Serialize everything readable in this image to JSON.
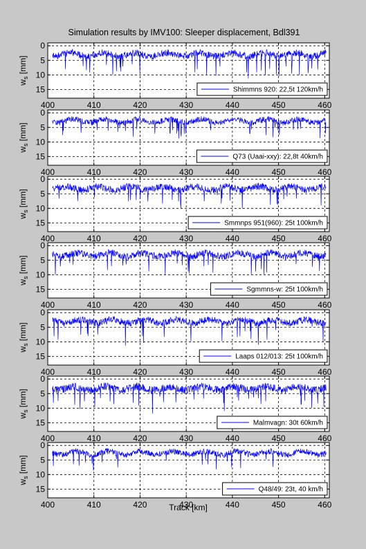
{
  "figure": {
    "title": "Simulation results by IMV100: Sleeper displacement, Bdl391",
    "xlabel": "Track [km]"
  },
  "chart_data": [
    {
      "type": "line",
      "ylabel": "w_s [mm]",
      "series": [
        {
          "name": "Shimmns 920: 22,5t 120km/h",
          "color": "#0000ff",
          "base": 3.0,
          "noise": 1.2,
          "spike": 7.5,
          "seed": 11
        }
      ],
      "xlim": [
        400,
        461
      ],
      "ylim": [
        18,
        -1
      ],
      "xticks": [
        400,
        410,
        420,
        430,
        440,
        450,
        460
      ],
      "yticks": [
        0,
        5,
        10,
        15
      ],
      "grid": true,
      "legend": "bottom-right"
    },
    {
      "type": "line",
      "ylabel": "w_s [mm]",
      "series": [
        {
          "name": "Q73 (Uaai-xxy): 22,8t 40km/h",
          "color": "#0000ff",
          "base": 2.8,
          "noise": 1.0,
          "spike": 5.5,
          "seed": 23
        }
      ],
      "xlim": [
        400,
        461
      ],
      "ylim": [
        18,
        -1
      ],
      "xticks": [
        400,
        410,
        420,
        430,
        440,
        450,
        460
      ],
      "yticks": [
        0,
        5,
        10,
        15
      ],
      "grid": true,
      "legend": "bottom-right"
    },
    {
      "type": "line",
      "ylabel": "w_s [mm]",
      "series": [
        {
          "name": "Smmnps 951(960): 25t 100km/h",
          "color": "#0000ff",
          "base": 3.1,
          "noise": 1.2,
          "spike": 7.0,
          "seed": 37
        }
      ],
      "xlim": [
        400,
        461
      ],
      "ylim": [
        18,
        -1
      ],
      "xticks": [
        400,
        410,
        420,
        430,
        440,
        450,
        460
      ],
      "yticks": [
        0,
        5,
        10,
        15
      ],
      "grid": true,
      "legend": "bottom-right"
    },
    {
      "type": "line",
      "ylabel": "w_s [mm]",
      "series": [
        {
          "name": "Sgmmns-w: 25t 100km/h",
          "color": "#0000ff",
          "base": 3.1,
          "noise": 1.2,
          "spike": 7.0,
          "seed": 41
        }
      ],
      "xlim": [
        400,
        461
      ],
      "ylim": [
        18,
        -1
      ],
      "xticks": [
        400,
        410,
        420,
        430,
        440,
        450,
        460
      ],
      "yticks": [
        0,
        5,
        10,
        15
      ],
      "grid": true,
      "legend": "bottom-right"
    },
    {
      "type": "line",
      "ylabel": "w_s [mm]",
      "series": [
        {
          "name": "Laaps 012/013: 25t 100km/h",
          "color": "#0000ff",
          "base": 3.0,
          "noise": 1.2,
          "spike": 7.2,
          "seed": 53
        }
      ],
      "xlim": [
        400,
        461
      ],
      "ylim": [
        18,
        -1
      ],
      "xticks": [
        400,
        410,
        420,
        430,
        440,
        450,
        460
      ],
      "yticks": [
        0,
        5,
        10,
        15
      ],
      "grid": true,
      "legend": "bottom-right"
    },
    {
      "type": "line",
      "ylabel": "w_s [mm]",
      "series": [
        {
          "name": "Malmvagn: 30t 60km/h",
          "color": "#0000ff",
          "base": 3.2,
          "noise": 1.3,
          "spike": 7.0,
          "seed": 67
        }
      ],
      "xlim": [
        400,
        461
      ],
      "ylim": [
        18,
        -1
      ],
      "xticks": [
        400,
        410,
        420,
        430,
        440,
        450,
        460
      ],
      "yticks": [
        0,
        5,
        10,
        15
      ],
      "grid": true,
      "legend": "bottom-right"
    },
    {
      "type": "line",
      "ylabel": "w_s [mm]",
      "series": [
        {
          "name": "Q48/49: 23t, 40 km/h",
          "color": "#0000ff",
          "base": 2.6,
          "noise": 1.0,
          "spike": 5.5,
          "seed": 79
        }
      ],
      "xlim": [
        400,
        461
      ],
      "ylim": [
        18,
        -1
      ],
      "xticks": [
        400,
        410,
        420,
        430,
        440,
        450,
        460
      ],
      "yticks": [
        0,
        5,
        10,
        15
      ],
      "grid": true,
      "legend": "bottom-right"
    }
  ]
}
